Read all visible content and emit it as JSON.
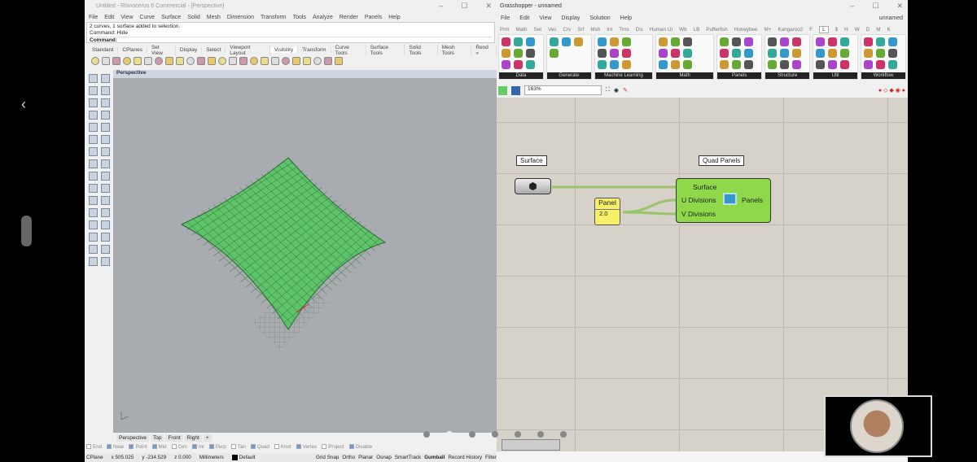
{
  "rhino": {
    "title": "Untitled - Rhinoceros 6 Commercial - [Perspective]",
    "menu": [
      "File",
      "Edit",
      "View",
      "Curve",
      "Surface",
      "Solid",
      "Mesh",
      "Dimension",
      "Transform",
      "Tools",
      "Analyze",
      "Render",
      "Panels",
      "Help"
    ],
    "history": [
      "2 curves, 1 surface added to selection.",
      "Command: Hide"
    ],
    "command_label": "Command:",
    "tabs": [
      "Standard",
      "CPlanes",
      "Set View",
      "Display",
      "Select",
      "Viewport Layout",
      "Visibility",
      "Transform",
      "Curve Tools",
      "Surface Tools",
      "Solid Tools",
      "Mesh Tools",
      "Rend »"
    ],
    "active_tab": "Visibility",
    "viewport_name": "Perspective",
    "viewport_tabs": [
      "Perspective",
      "Top",
      "Front",
      "Right",
      "+"
    ],
    "osnaps": [
      {
        "label": "End",
        "on": false
      },
      {
        "label": "Near",
        "on": true
      },
      {
        "label": "Point",
        "on": true
      },
      {
        "label": "Mid",
        "on": true
      },
      {
        "label": "Cen",
        "on": false
      },
      {
        "label": "Int",
        "on": true
      },
      {
        "label": "Perp",
        "on": true
      },
      {
        "label": "Tan",
        "on": false
      },
      {
        "label": "Quad",
        "on": true
      },
      {
        "label": "Knot",
        "on": false
      },
      {
        "label": "Vertex",
        "on": true
      },
      {
        "label": "Project",
        "on": false
      },
      {
        "label": "Disable",
        "on": true
      }
    ],
    "status": {
      "cplane": "CPlane",
      "x": "x 505.025",
      "y": "y -234.529",
      "z": "z 0.000",
      "units": "Millimeters",
      "layer": "Default",
      "toggles": [
        "Grid Snap",
        "Ortho",
        "Planar",
        "Osnap",
        "SmartTrack",
        "Gumball",
        "Record History",
        "Filter"
      ]
    }
  },
  "gh": {
    "title": "Grasshopper - unnamed",
    "doc_name": "unnamed",
    "menu": [
      "File",
      "Edit",
      "View",
      "Display",
      "Solution",
      "Help"
    ],
    "tabs": [
      "Prm",
      "Math",
      "Set",
      "Vec",
      "Crv",
      "Srf",
      "Msh",
      "Int",
      "Trns",
      "Dis",
      "Human UI",
      "Wb",
      "LB",
      "Pufferfish",
      "Honeybee",
      "M+",
      "Kangaroo2",
      "F",
      "L",
      "$",
      "H",
      "W",
      "D",
      "M",
      "K"
    ],
    "groups": [
      "Data",
      "Generate",
      "Machine Learning",
      "Math",
      "Panels",
      "Structure",
      "Util",
      "Workflow"
    ],
    "zoom": "163%",
    "nodes": {
      "surface_label": "Surface",
      "quad_label": "Quad Panels",
      "panel_title": "Panel",
      "panel_value": "2.0",
      "inputs": [
        "Surface",
        "U Divisions",
        "V Divisions"
      ],
      "output": "Panels"
    },
    "colors": {
      "component": "#8fd84a",
      "panel": "#f5ef6a",
      "wire": "#9ac468"
    }
  }
}
